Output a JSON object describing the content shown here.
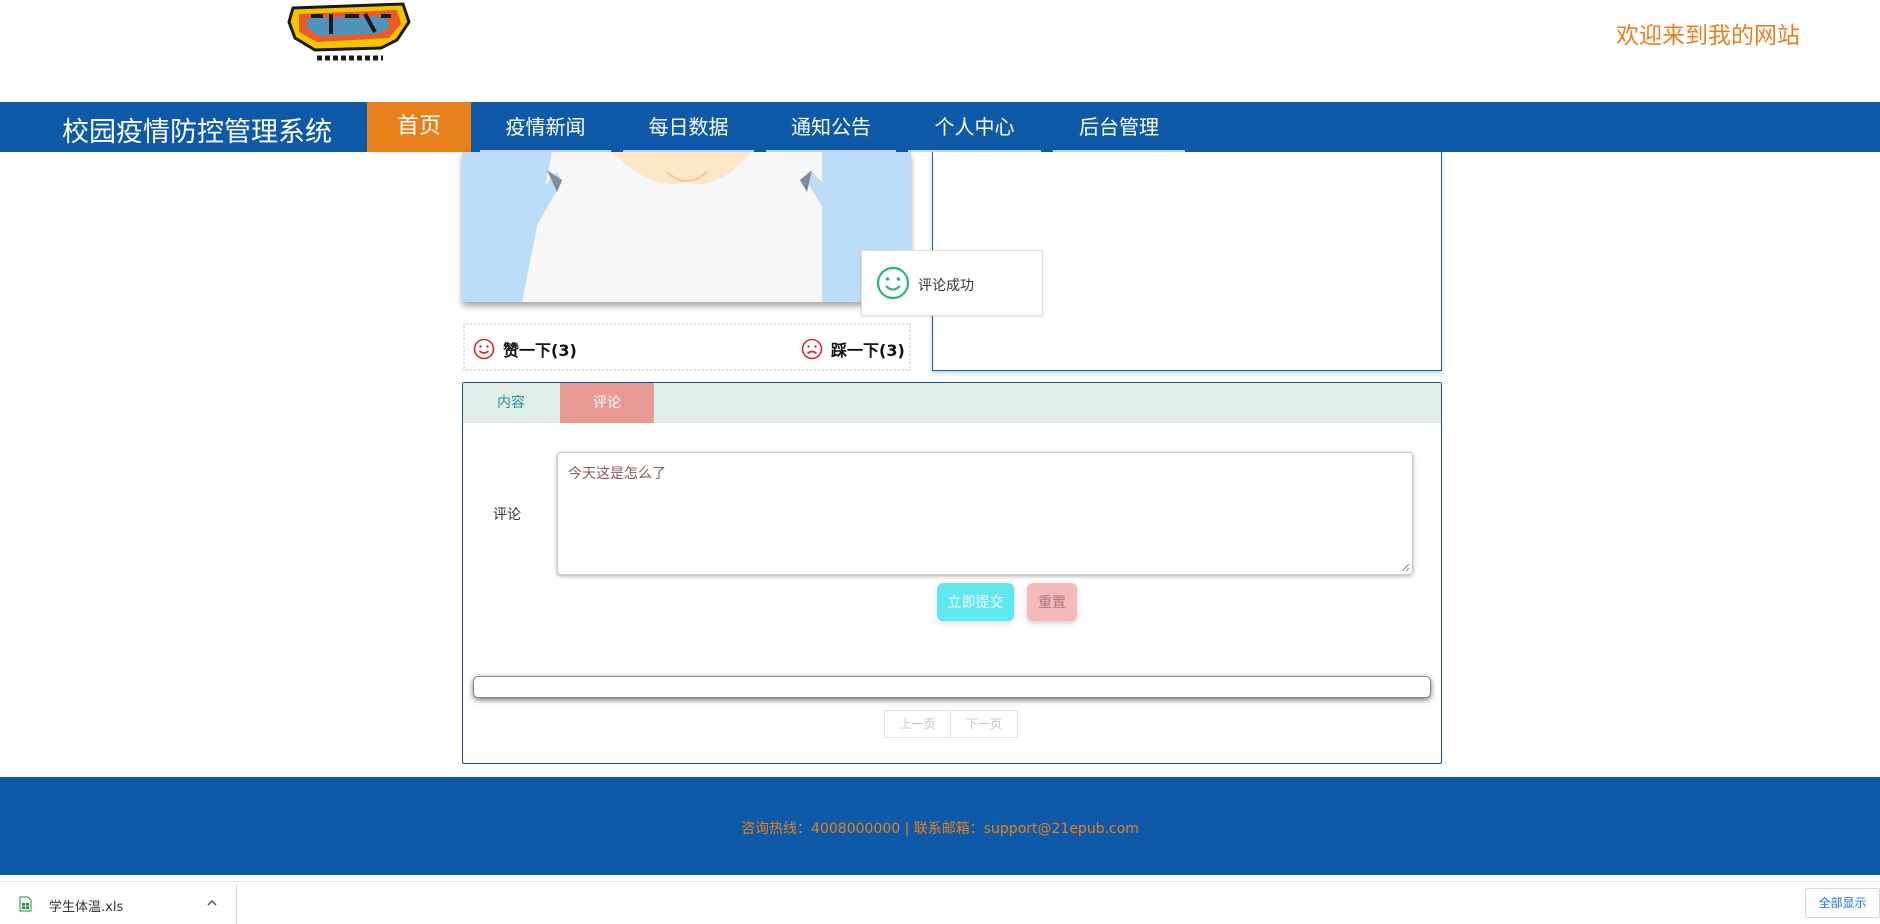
{
  "header": {
    "welcome_text": "欢迎来到我的网站"
  },
  "nav": {
    "site_title": "校园疫情防控管理系统",
    "items": [
      {
        "label": "首页",
        "active": true
      },
      {
        "label": "疫情新闻",
        "active": false
      },
      {
        "label": "每日数据",
        "active": false
      },
      {
        "label": "通知公告",
        "active": false
      },
      {
        "label": "个人中心",
        "active": false
      },
      {
        "label": "后台管理",
        "active": false
      }
    ]
  },
  "toast": {
    "message": "评论成功",
    "icon": "smile-icon"
  },
  "votes": {
    "like_label": "赞一下(3)",
    "dislike_label": "踩一下(3)"
  },
  "tabs": [
    {
      "label": "内容",
      "active": false
    },
    {
      "label": "评论",
      "active": true
    }
  ],
  "comment_form": {
    "label": "评论",
    "value": "今天这是怎么了",
    "submit_label": "立即提交",
    "reset_label": "重置"
  },
  "pager": {
    "prev_label": "上一页",
    "next_label": "下一页"
  },
  "footer": {
    "contact_text": "咨询热线：4008000000 | 联系邮箱：support@21epub.com"
  },
  "download_bar": {
    "file_name": "学生体温.xls",
    "show_all_label": "全部显示"
  },
  "colors": {
    "nav_blue": "#0f5aa8",
    "active_orange": "#e8801c",
    "tab_active": "#e99a92",
    "submit_cyan": "#5fe8ef"
  }
}
